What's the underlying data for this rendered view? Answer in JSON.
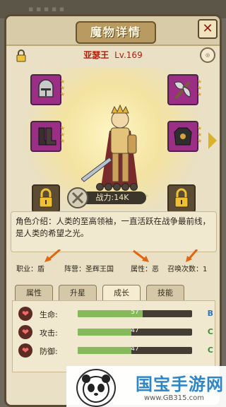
{
  "window": {
    "title": "魔物详情",
    "close_symbol": "✕"
  },
  "hero": {
    "name": "亚瑟王",
    "level": "Lv.169",
    "rating_stars": 5
  },
  "equipment": [
    {
      "slot": "helmet",
      "icon": "helmet-icon",
      "stars": 3
    },
    {
      "slot": "weapon",
      "icon": "axe-icon",
      "stars": 3
    },
    {
      "slot": "boots",
      "icon": "boots-icon",
      "stars": 3
    },
    {
      "slot": "armor",
      "icon": "armor-icon",
      "stars": 3
    }
  ],
  "power": {
    "label": "战力:14K"
  },
  "description": "角色介绍：人类的至高领袖，一直活跃在战争最前线，是人类的希望之光。",
  "info": {
    "job": "职业：盾",
    "camp": "阵营：圣辉王国",
    "attr": "属性：恶",
    "summons": "召唤次数：1"
  },
  "tabs": [
    {
      "label": "属性",
      "active": false
    },
    {
      "label": "升星",
      "active": false
    },
    {
      "label": "成长",
      "active": true
    },
    {
      "label": "技能",
      "active": false
    }
  ],
  "stats": [
    {
      "label": "生命:",
      "value": "57",
      "fill": 0.57,
      "grade": "B",
      "grade_color": "#2a79c4"
    },
    {
      "label": "攻击:",
      "value": "47",
      "fill": 0.47,
      "grade": "C",
      "grade_color": "#3b8e3b"
    },
    {
      "label": "防御:",
      "value": "47",
      "fill": 0.47,
      "grade": "C",
      "grade_color": "#3b8e3b"
    }
  ],
  "watermark": {
    "title": "国宝手游网",
    "url": "www.GB315.com"
  },
  "colors": {
    "accent_red": "#b31d0c",
    "slot_purple": "#9b2f86",
    "bar_green": "#86b95b",
    "annotation_orange": "#e3650d"
  }
}
